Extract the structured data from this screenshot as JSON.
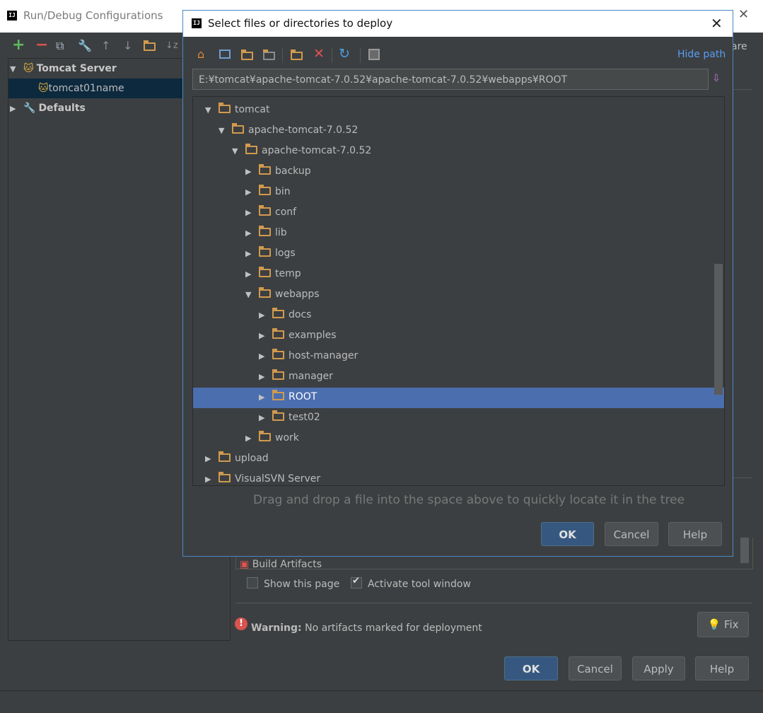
{
  "outer": {
    "title": "Run/Debug Configurations",
    "logo": "IJ",
    "toolbar_icons": [
      "add-icon",
      "remove-icon",
      "copy-icon",
      "wrench-icon",
      "arrow-up-icon",
      "arrow-down-icon",
      "folder-icon",
      "sort-icon"
    ],
    "tree": {
      "server_group": "Tomcat Server",
      "server_item": "tomcat01name",
      "defaults": "Defaults"
    },
    "right_partial_text": "are",
    "build_artifacts": "Build Artifacts",
    "show_this_page": "Show this page",
    "activate_tool_window": "Activate tool window",
    "warning_label": "Warning:",
    "warning_text": "No artifacts marked for deployment",
    "fix_label": "Fix",
    "buttons": {
      "ok": "OK",
      "cancel": "Cancel",
      "apply": "Apply",
      "help": "Help"
    }
  },
  "dialog": {
    "title": "Select files or directories to deploy",
    "logo": "IJ",
    "toolbar_icons": [
      "home-icon",
      "desktop-icon",
      "project-folder-icon",
      "module-folder-icon",
      "new-folder-icon",
      "delete-icon",
      "refresh-icon",
      "show-hidden-icon"
    ],
    "hide_path": "Hide path",
    "path": "E:¥tomcat¥apache-tomcat-7.0.52¥apache-tomcat-7.0.52¥webapps¥ROOT",
    "tree": [
      {
        "label": "tomcat",
        "expanded": true
      },
      {
        "label": "apache-tomcat-7.0.52",
        "expanded": true
      },
      {
        "label": "apache-tomcat-7.0.52",
        "expanded": true
      },
      {
        "label": "backup",
        "expanded": false
      },
      {
        "label": "bin",
        "expanded": false
      },
      {
        "label": "conf",
        "expanded": false
      },
      {
        "label": "lib",
        "expanded": false
      },
      {
        "label": "logs",
        "expanded": false
      },
      {
        "label": "temp",
        "expanded": false
      },
      {
        "label": "webapps",
        "expanded": true
      },
      {
        "label": "docs",
        "expanded": false
      },
      {
        "label": "examples",
        "expanded": false
      },
      {
        "label": "host-manager",
        "expanded": false
      },
      {
        "label": "manager",
        "expanded": false
      },
      {
        "label": "ROOT",
        "expanded": false,
        "selected": true
      },
      {
        "label": "test02",
        "expanded": false
      },
      {
        "label": "work",
        "expanded": false
      },
      {
        "label": "upload",
        "expanded": false
      },
      {
        "label": "VisualSVN Server",
        "expanded": false
      }
    ],
    "hint": "Drag and drop a file into the space above to quickly locate it in the tree",
    "buttons": {
      "ok": "OK",
      "cancel": "Cancel",
      "help": "Help"
    }
  },
  "colors": {
    "background": "#3c3f41",
    "selection": "#4b6eaf",
    "folder": "#d19a4e",
    "link": "#589df6",
    "primary_button": "#365880"
  }
}
